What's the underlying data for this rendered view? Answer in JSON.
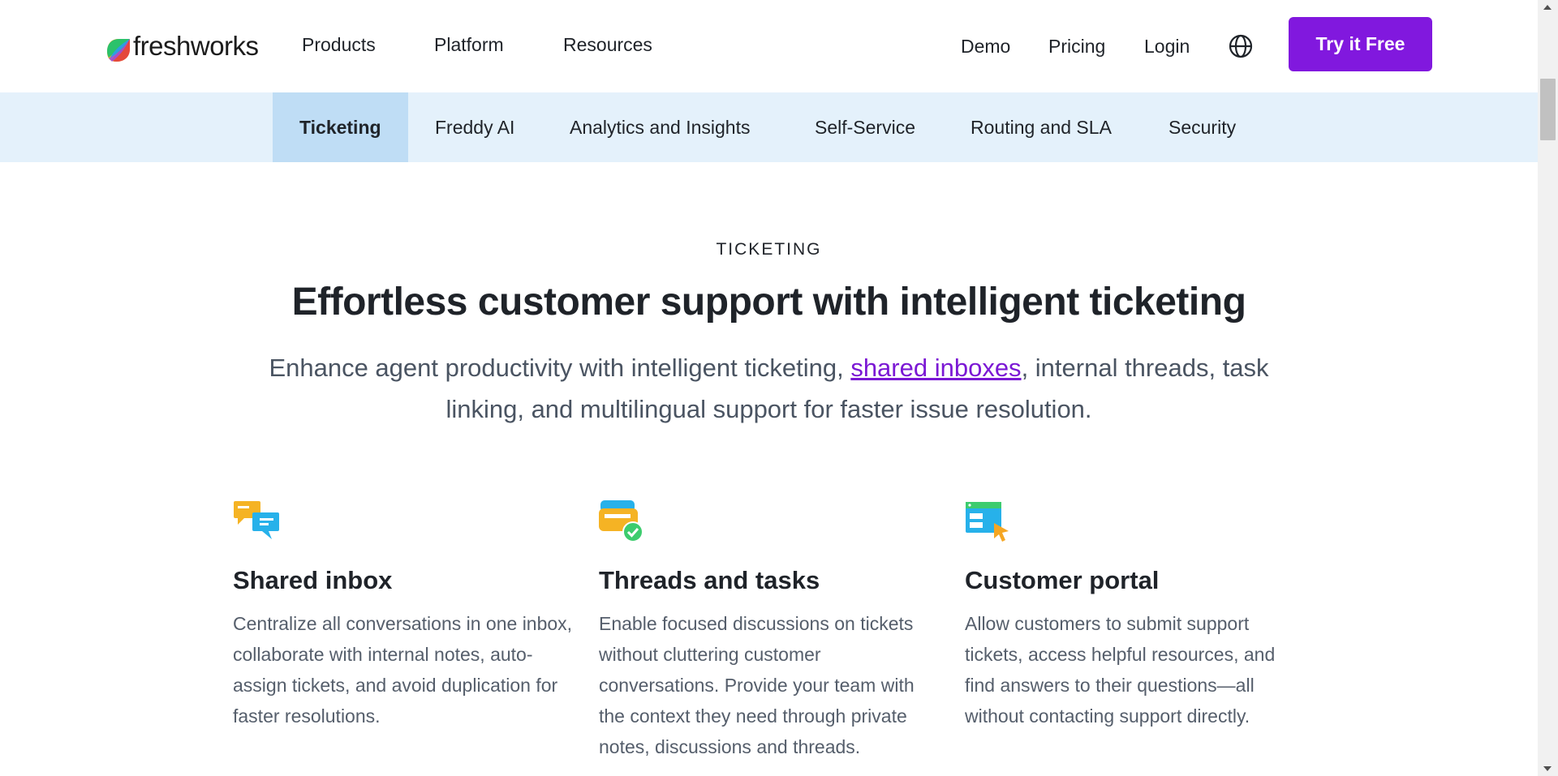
{
  "brand": {
    "name": "freshworks"
  },
  "nav": {
    "products": "Products",
    "platform": "Platform",
    "resources": "Resources",
    "demo": "Demo",
    "pricing": "Pricing",
    "login": "Login",
    "cta": "Try it Free"
  },
  "subnav": {
    "tabs": [
      "Ticketing",
      "Freddy AI",
      "Analytics and Insights",
      "Self-Service",
      "Routing and SLA",
      "Security"
    ],
    "active": "Ticketing"
  },
  "hero": {
    "eyebrow": "TICKETING",
    "title": "Effortless customer support with intelligent ticketing",
    "lede_before": "Enhance agent productivity with intelligent ticketing, ",
    "lede_link": "shared inboxes",
    "lede_after": ", internal threads, task linking, and multilingual support for faster issue resolution."
  },
  "features": [
    {
      "icon": "chat-bubbles-icon",
      "title": "Shared inbox",
      "description": "Centralize all conversations in one inbox, collaborate with internal notes, auto-assign tickets, and avoid duplication for faster resolutions."
    },
    {
      "icon": "tasks-check-icon",
      "title": "Threads and tasks",
      "description": "Enable focused discussions on tickets without cluttering customer conversations. Provide your team with the context they need through private notes, discussions and threads."
    },
    {
      "icon": "portal-cursor-icon",
      "title": "Customer portal",
      "description": "Allow customers to submit support tickets, access helpful resources, and find answers to their questions—all without contacting support directly."
    }
  ],
  "colors": {
    "accent": "#8118de",
    "link": "#7b18d4",
    "subnav_bg": "#e4f1fb",
    "subnav_active": "#bfddf5"
  }
}
